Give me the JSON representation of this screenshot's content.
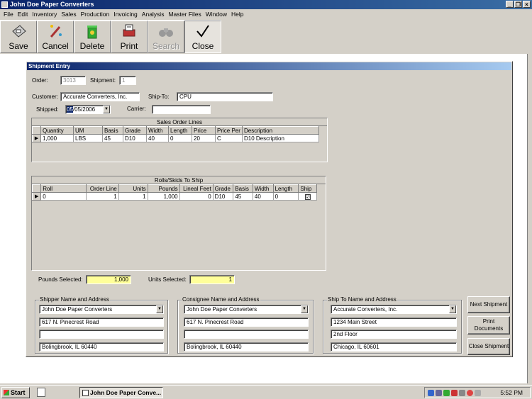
{
  "window": {
    "title": "John Doe Paper Converters",
    "buttons": [
      "_",
      "❐",
      "×"
    ]
  },
  "menu": [
    "File",
    "Edit",
    "Inventory",
    "Sales",
    "Production",
    "Invoicing",
    "Analysis",
    "Master Files",
    "Window",
    "Help"
  ],
  "toolbar": {
    "save": "Save",
    "cancel": "Cancel",
    "delete": "Delete",
    "print": "Print",
    "search": "Search",
    "close": "Close"
  },
  "form": {
    "title": "Shipment Entry",
    "order_label": "Order:",
    "order_value": "3013",
    "shipment_label": "Shipment:",
    "shipment_value": "1",
    "customer_label": "Customer:",
    "customer_value": "Accurate Converters, Inc.",
    "shipto_label": "Ship-To:",
    "shipto_value": "CPU",
    "shipped_label": "Shipped:",
    "shipped_sel": "05",
    "shipped_rest": "/05/2006",
    "carrier_label": "Carrier:",
    "carrier_value": ""
  },
  "sales_lines": {
    "caption": "Sales Order Lines",
    "headers": [
      "Quantity",
      "UM",
      "Basis",
      "Grade",
      "Width",
      "Length",
      "Price",
      "Price Per",
      "Description"
    ],
    "rows": [
      [
        "1,000",
        "LBS",
        "45",
        "D10",
        "40",
        "0",
        "20",
        "C",
        "D10 Description"
      ]
    ]
  },
  "rolls": {
    "caption": "Rolls/Skids To Ship",
    "headers": [
      "Roll",
      "Order Line",
      "Units",
      "Pounds",
      "Lineal Feet",
      "Grade",
      "Basis",
      "Width",
      "Length",
      "Ship"
    ],
    "rows": [
      [
        "0",
        "1",
        "1",
        "1,000",
        "0",
        "D10",
        "45",
        "40",
        "0",
        "☑"
      ]
    ]
  },
  "totals": {
    "pounds_label": "Pounds Selected:",
    "pounds_value": "1,000",
    "units_label": "Units Selected:",
    "units_value": "1"
  },
  "shipper": {
    "caption": "Shipper Name and Address",
    "name": "John Doe Paper Converters",
    "addr1": "617 N. Pinecrest Road",
    "addr2": "",
    "city": "Bolingbrook, IL  60440"
  },
  "consignee": {
    "caption": "Consignee Name and Address",
    "name": "John Doe Paper Converters",
    "addr1": "617 N. Pinecrest Road",
    "addr2": "",
    "city": "Bolingbrook, IL  60440"
  },
  "shipto_addr": {
    "caption": "Ship To Name and Address",
    "name": "Accurate Converters, Inc.",
    "addr1": "1234 Main Street",
    "addr2": "2nd Floor",
    "city": "Chicago, IL  60601"
  },
  "buttons": {
    "next": "Next Shipment",
    "print_docs_1": "Print",
    "print_docs_2": "Documents",
    "close": "Close Shipment"
  },
  "taskbar": {
    "start": "Start",
    "task": "John Doe Paper Conve...",
    "clock": "5:52 PM"
  }
}
